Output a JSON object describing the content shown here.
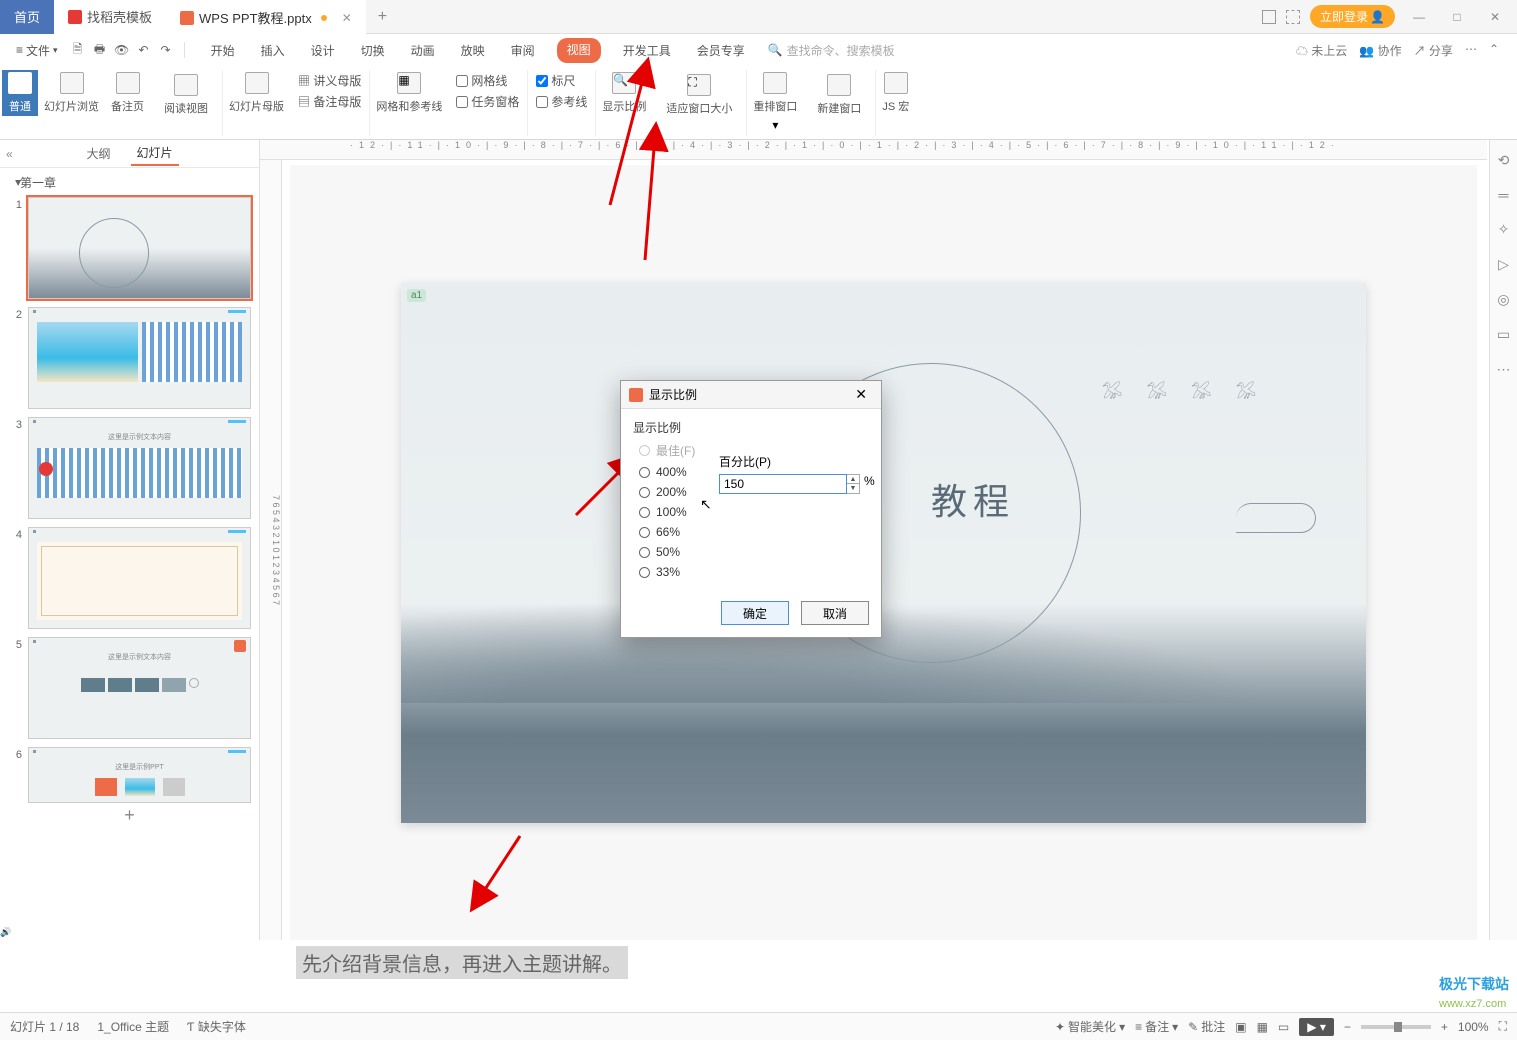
{
  "tabs": {
    "home": "首页",
    "template": "找稻壳模板",
    "file": "WPS PPT教程.pptx",
    "add": "+"
  },
  "titlebar_right": {
    "login": "立即登录"
  },
  "file_menu": "文件",
  "menutabs": [
    "开始",
    "插入",
    "设计",
    "切换",
    "动画",
    "放映",
    "审阅",
    "视图",
    "开发工具",
    "会员专享"
  ],
  "active_menu": "视图",
  "search_placeholder": "查找命令、搜索模板",
  "menubar_right": {
    "notcloud": "未上云",
    "coop": "协作",
    "share": "分享"
  },
  "ribbon": {
    "normal": "普通",
    "sorter": "幻灯片浏览",
    "notes": "备注页",
    "reading": "阅读视图",
    "slide_master": "幻灯片母版",
    "handout_master": "讲义母版",
    "notes_master": "备注母版",
    "grid_guide": "网格和参考线",
    "gridlines": "网格线",
    "taskpane": "任务窗格",
    "ruler": "标尺",
    "guides": "参考线",
    "zoom": "显示比例",
    "fit": "适应窗口大小",
    "arrange": "重排窗口",
    "newwin": "新建窗口",
    "jsmacro": "JS 宏"
  },
  "left": {
    "outline": "大纲",
    "slides": "幻灯片",
    "section": "第一章",
    "count": 6
  },
  "dialog": {
    "title": "显示比例",
    "section": "显示比例",
    "best": "最佳(F)",
    "options": [
      "400%",
      "200%",
      "100%",
      "66%",
      "50%",
      "33%"
    ],
    "pct_label": "百分比(P)",
    "pct_value": "150",
    "pct_sign": "%",
    "ok": "确定",
    "cancel": "取消"
  },
  "slide": {
    "title": "教程",
    "a1": "a1"
  },
  "notes": "先介绍背景信息，再进入主题讲解。",
  "status": {
    "slide": "幻灯片 1 / 18",
    "theme": "1_Office 主题",
    "missingfont": "缺失字体",
    "beautify": "智能美化",
    "note": "备注",
    "review": "批注",
    "zoom": "100%"
  },
  "watermark": {
    "brand": "极光下载站",
    "url": "www.xz7.com"
  }
}
